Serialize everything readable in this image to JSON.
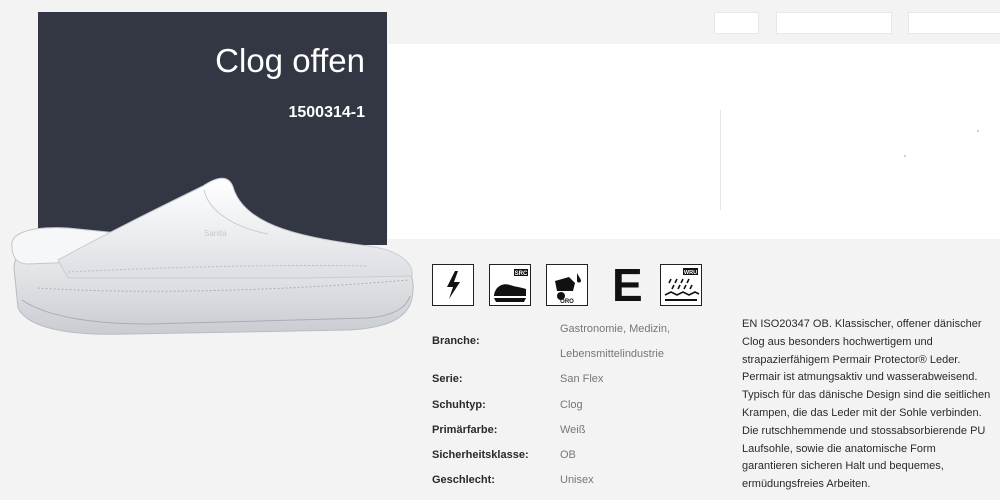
{
  "product": {
    "title": "Clog offen",
    "sku": "1500314-1"
  },
  "shoe_brand": "Sanita",
  "icons": [
    {
      "name": "antistatic-icon"
    },
    {
      "name": "src-slip-resistance-icon",
      "label": "SRC"
    },
    {
      "name": "oil-resistance-icon",
      "label": "ORO"
    },
    {
      "name": "energy-absorption-icon",
      "label": "E"
    },
    {
      "name": "water-resistance-icon",
      "label": "WRU"
    }
  ],
  "specs": {
    "branche_label": "Branche:",
    "branche_value_line1": "Gastronomie, Medizin,",
    "branche_value_line2": "Lebensmittelindustrie",
    "serie_label": "Serie:",
    "serie_value": "San Flex",
    "schuhtyp_label": "Schuhtyp:",
    "schuhtyp_value": "Clog",
    "farbe_label": "Primärfarbe:",
    "farbe_value": "Weiß",
    "klasse_label": "Sicherheitsklasse:",
    "klasse_value": "OB",
    "geschlecht_label": "Geschlecht:",
    "geschlecht_value": "Unisex"
  },
  "description": "EN ISO20347 OB. Klassischer, offener dänischer Clog aus besonders hochwertigem und strapazierfähigem Permair Protector® Leder. Permair ist atmungsaktiv und wasserabweisend. Typisch für das dänische Design sind die seitlichen Krampen, die das Leder mit der Sohle verbinden. Die rutschhemmende und stossabsorbierende PU Laufsohle, sowie die anatomische Form garantieren sicheren Halt und bequemes, ermüdungsfreies Arbeiten.",
  "colors": {
    "hero_bg": "#333743",
    "page_bg": "#f3f3f3",
    "value_text": "#777777"
  }
}
